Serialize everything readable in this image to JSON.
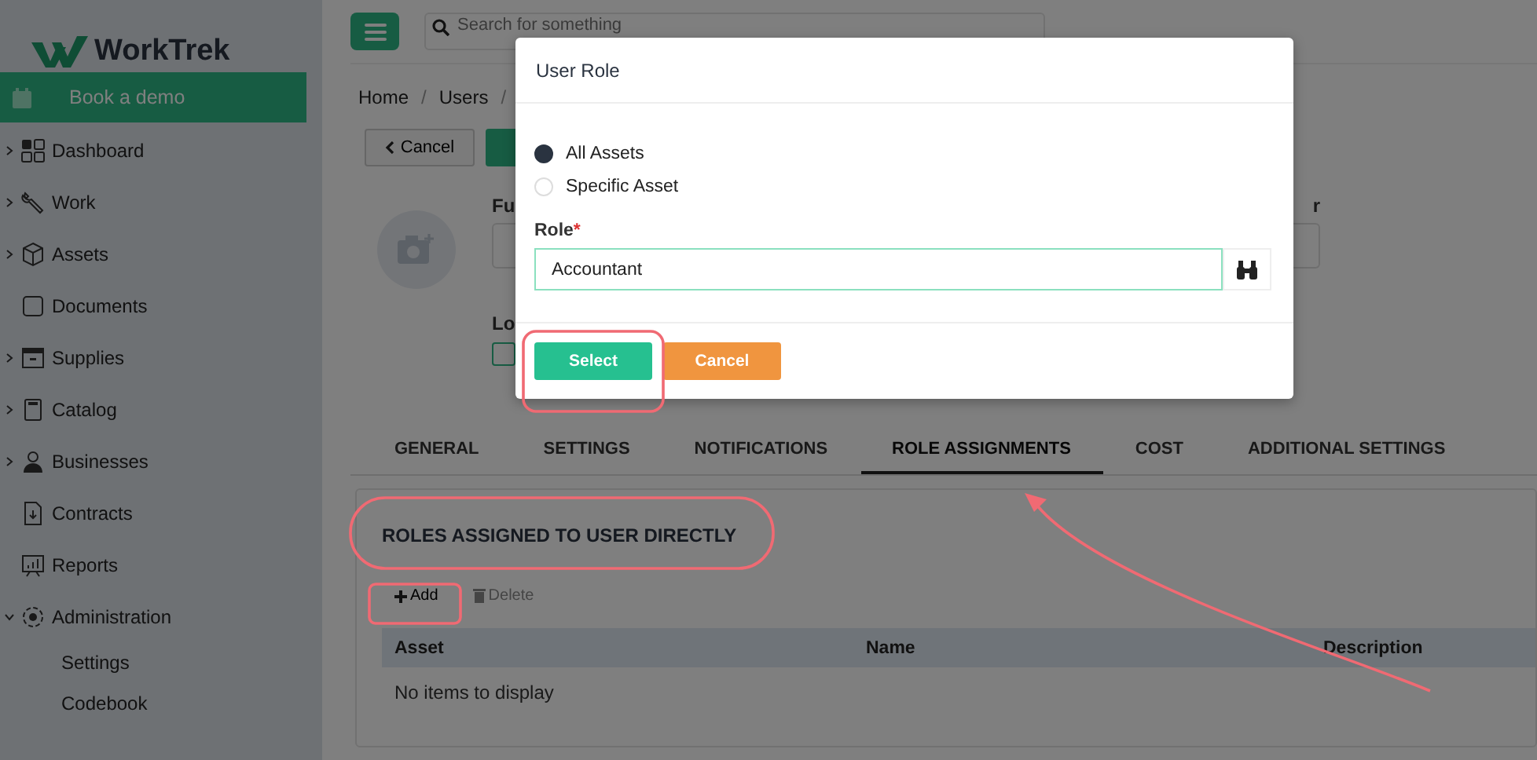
{
  "sidebar": {
    "logo": "WorkTrek",
    "cta": "Book a demo",
    "items": [
      {
        "label": "Dashboard",
        "kind": "group",
        "expanded": false
      },
      {
        "label": "Work",
        "kind": "group",
        "expanded": false
      },
      {
        "label": "Assets",
        "kind": "group",
        "expanded": false
      },
      {
        "label": "Documents",
        "kind": "link"
      },
      {
        "label": "Supplies",
        "kind": "group",
        "expanded": false
      },
      {
        "label": "Catalog",
        "kind": "group",
        "expanded": false
      },
      {
        "label": "Businesses",
        "kind": "group",
        "expanded": false
      },
      {
        "label": "Contracts",
        "kind": "link"
      },
      {
        "label": "Reports",
        "kind": "link"
      },
      {
        "label": "Administration",
        "kind": "group",
        "expanded": true,
        "children": [
          {
            "label": "Settings"
          },
          {
            "label": "Codebook"
          }
        ]
      }
    ]
  },
  "search": {
    "placeholder": "Search for something"
  },
  "breadcrumb": {
    "items": [
      "Home",
      "Users"
    ],
    "separator": "/"
  },
  "toolbar": {
    "cancel": "Cancel"
  },
  "form": {
    "label_1": "Fu",
    "label_2": "Lo",
    "label_3": "r",
    "checkbox": {
      "checked": false
    }
  },
  "tabs": [
    {
      "label": "GENERAL",
      "selected": false
    },
    {
      "label": "SETTINGS",
      "selected": false
    },
    {
      "label": "NOTIFICATIONS",
      "selected": false
    },
    {
      "label": "ROLE ASSIGNMENTS",
      "selected": true
    },
    {
      "label": "COST",
      "selected": false
    },
    {
      "label": "ADDITIONAL SETTINGS",
      "selected": false
    }
  ],
  "section": {
    "title": "ROLES ASSIGNED TO USER DIRECTLY",
    "add": "Add",
    "delete": {
      "label": "Delete",
      "disabled": true
    },
    "columns": [
      "Asset",
      "Name",
      "Description"
    ],
    "empty": "No items to display"
  },
  "modal": {
    "title": "User Role",
    "options": [
      {
        "label": "All Assets",
        "selected": true
      },
      {
        "label": "Specific Asset",
        "selected": false
      }
    ],
    "role_label": "Role",
    "required_mark": "*",
    "role_value": "Accountant",
    "buttons": [
      {
        "label": "Select",
        "kind": "primary"
      },
      {
        "label": "Cancel",
        "kind": "secondary"
      }
    ]
  }
}
